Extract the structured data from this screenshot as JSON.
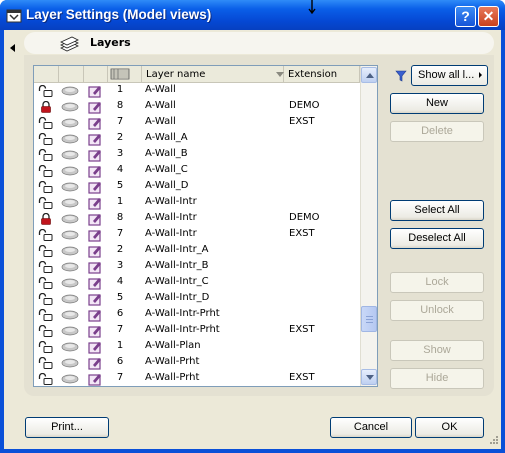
{
  "window": {
    "title": "Layer Settings (Model views)",
    "help_label": "?",
    "close_label": "✕"
  },
  "group": {
    "title": "Layers"
  },
  "list": {
    "headers": {
      "name": "Layer name",
      "extension": "Extension"
    },
    "rows": [
      {
        "lock": "unlocked",
        "num": "1",
        "name": "A-Wall",
        "ext": ""
      },
      {
        "lock": "locked",
        "num": "8",
        "name": "A-Wall",
        "ext": "DEMO"
      },
      {
        "lock": "unlocked",
        "num": "7",
        "name": "A-Wall",
        "ext": "EXST"
      },
      {
        "lock": "unlocked",
        "num": "2",
        "name": "A-Wall_A",
        "ext": ""
      },
      {
        "lock": "unlocked",
        "num": "3",
        "name": "A-Wall_B",
        "ext": ""
      },
      {
        "lock": "unlocked",
        "num": "4",
        "name": "A-Wall_C",
        "ext": ""
      },
      {
        "lock": "unlocked",
        "num": "5",
        "name": "A-Wall_D",
        "ext": ""
      },
      {
        "lock": "unlocked",
        "num": "1",
        "name": "A-Wall-Intr",
        "ext": ""
      },
      {
        "lock": "locked",
        "num": "8",
        "name": "A-Wall-Intr",
        "ext": "DEMO"
      },
      {
        "lock": "unlocked",
        "num": "7",
        "name": "A-Wall-Intr",
        "ext": "EXST"
      },
      {
        "lock": "unlocked",
        "num": "2",
        "name": "A-Wall-Intr_A",
        "ext": ""
      },
      {
        "lock": "unlocked",
        "num": "3",
        "name": "A-Wall-Intr_B",
        "ext": ""
      },
      {
        "lock": "unlocked",
        "num": "4",
        "name": "A-Wall-Intr_C",
        "ext": ""
      },
      {
        "lock": "unlocked",
        "num": "5",
        "name": "A-Wall-Intr_D",
        "ext": ""
      },
      {
        "lock": "unlocked",
        "num": "6",
        "name": "A-Wall-Intr-Prht",
        "ext": ""
      },
      {
        "lock": "unlocked",
        "num": "7",
        "name": "A-Wall-Intr-Prht",
        "ext": "EXST"
      },
      {
        "lock": "unlocked",
        "num": "1",
        "name": "A-Wall-Plan",
        "ext": ""
      },
      {
        "lock": "unlocked",
        "num": "6",
        "name": "A-Wall-Prht",
        "ext": ""
      },
      {
        "lock": "unlocked",
        "num": "7",
        "name": "A-Wall-Prht",
        "ext": "EXST"
      }
    ]
  },
  "side": {
    "filter_value": "Show all l...",
    "new": "New",
    "delete": "Delete",
    "select_all": "Select All",
    "deselect_all": "Deselect All",
    "lock": "Lock",
    "unlock": "Unlock",
    "show": "Show",
    "hide": "Hide"
  },
  "footer": {
    "print": "Print...",
    "cancel": "Cancel",
    "ok": "OK"
  },
  "colors": {
    "titlebar": "#0a5fe8",
    "dialog_bg": "#ece9d8",
    "lock_locked": "#c0141c",
    "edit_icon": "#7a3f8c"
  }
}
